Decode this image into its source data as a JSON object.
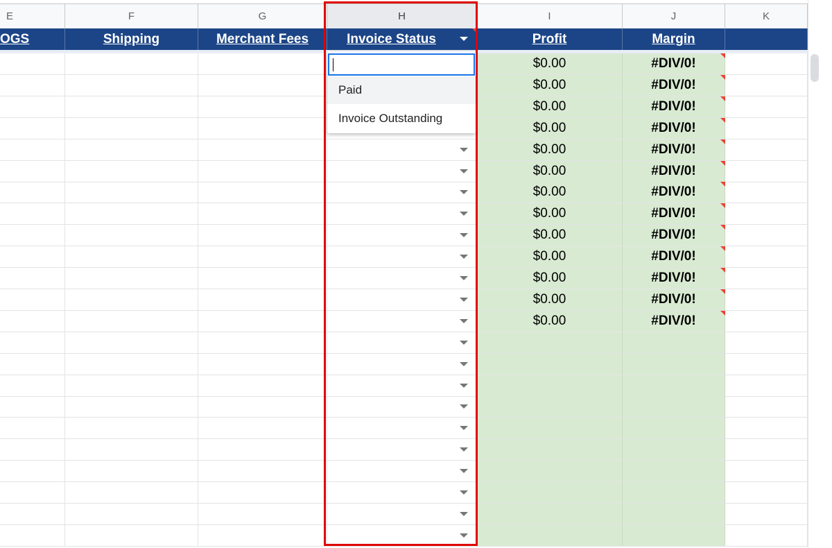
{
  "columns": [
    {
      "letter": "E",
      "header": "OGS"
    },
    {
      "letter": "F",
      "header": "Shipping"
    },
    {
      "letter": "G",
      "header": "Merchant Fees"
    },
    {
      "letter": "H",
      "header": "Invoice Status"
    },
    {
      "letter": "I",
      "header": "Profit"
    },
    {
      "letter": "J",
      "header": "Margin"
    },
    {
      "letter": "K",
      "header": ""
    }
  ],
  "dropdown": {
    "input_value": "",
    "options": [
      "Paid",
      "Invoice Outstanding"
    ]
  },
  "rows": [
    {
      "profit": "$0.00",
      "margin": "#DIV/0!"
    },
    {
      "profit": "$0.00",
      "margin": "#DIV/0!"
    },
    {
      "profit": "$0.00",
      "margin": "#DIV/0!"
    },
    {
      "profit": "$0.00",
      "margin": "#DIV/0!"
    },
    {
      "profit": "$0.00",
      "margin": "#DIV/0!"
    },
    {
      "profit": "$0.00",
      "margin": "#DIV/0!"
    },
    {
      "profit": "$0.00",
      "margin": "#DIV/0!"
    },
    {
      "profit": "$0.00",
      "margin": "#DIV/0!"
    },
    {
      "profit": "$0.00",
      "margin": "#DIV/0!"
    },
    {
      "profit": "$0.00",
      "margin": "#DIV/0!"
    },
    {
      "profit": "$0.00",
      "margin": "#DIV/0!"
    },
    {
      "profit": "$0.00",
      "margin": "#DIV/0!"
    },
    {
      "profit": "$0.00",
      "margin": "#DIV/0!"
    },
    {
      "profit": "",
      "margin": ""
    },
    {
      "profit": "",
      "margin": ""
    },
    {
      "profit": "",
      "margin": ""
    },
    {
      "profit": "",
      "margin": ""
    },
    {
      "profit": "",
      "margin": ""
    },
    {
      "profit": "",
      "margin": ""
    },
    {
      "profit": "",
      "margin": ""
    },
    {
      "profit": "",
      "margin": ""
    },
    {
      "profit": "",
      "margin": ""
    },
    {
      "profit": "",
      "margin": ""
    }
  ],
  "colors": {
    "header_bg": "#1c4587",
    "calc_fill": "#d9ead3",
    "highlight_border": "#e00000",
    "selection_blue": "#1a73e8"
  }
}
